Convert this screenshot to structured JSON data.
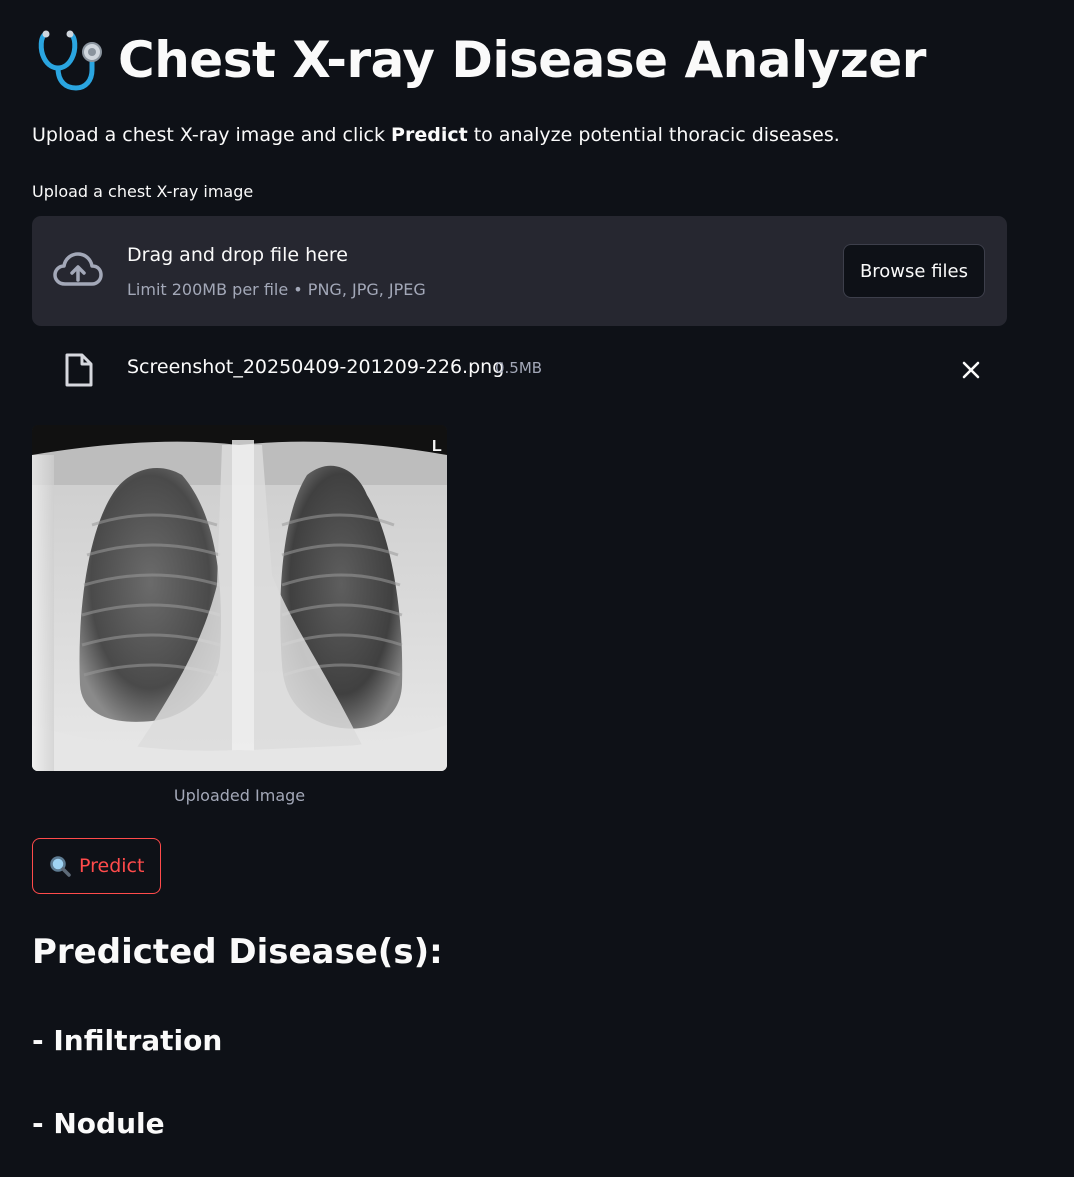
{
  "header": {
    "title": "Chest X-ray Disease Analyzer",
    "icon": "stethoscope-icon"
  },
  "intro": {
    "before": "Upload a chest X-ray image and click ",
    "bold": "Predict",
    "after": " to analyze potential thoracic diseases."
  },
  "uploader": {
    "label": "Upload a chest X-ray image",
    "dropzone_title": "Drag and drop file here",
    "dropzone_limit": "Limit 200MB per file • PNG, JPG, JPEG",
    "browse_label": "Browse files",
    "icon": "cloud-upload-icon"
  },
  "uploaded_file": {
    "name": "Screenshot_20250409-201209-226.png",
    "size": "0.5MB",
    "icon": "file-icon"
  },
  "image": {
    "caption": "Uploaded Image",
    "marker": "L"
  },
  "predict_button": {
    "label": "Predict",
    "icon": "magnifier-icon"
  },
  "results": {
    "heading": "Predicted Disease(s):",
    "items": [
      "- Infiltration",
      "- Nodule"
    ]
  },
  "colors": {
    "background": "#0e1117",
    "surface": "#262730",
    "accent": "#ff4b4b",
    "muted_text": "#a3a8b8",
    "text": "#fafafa"
  }
}
